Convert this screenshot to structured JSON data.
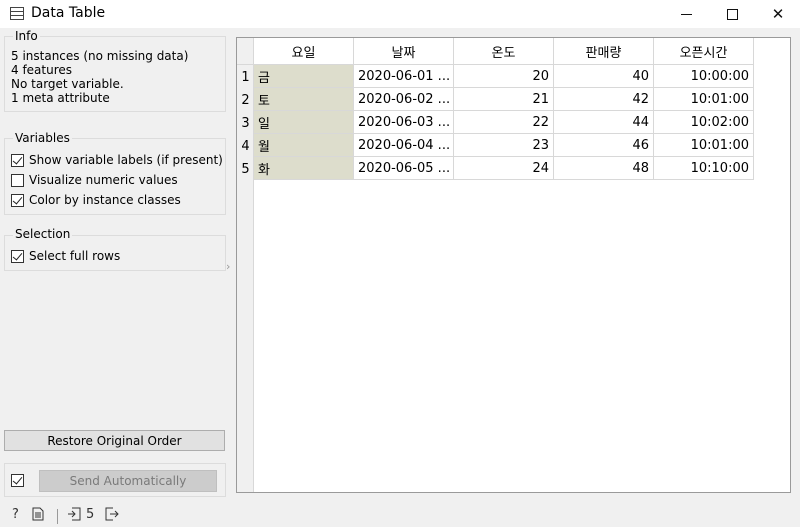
{
  "window": {
    "title": "Data Table",
    "minimize_icon": "minimize-icon",
    "maximize_icon": "maximize-icon",
    "close_icon": "close-icon",
    "close_glyph": "✕"
  },
  "info": {
    "title": "Info",
    "lines": [
      "5 instances (no missing data)",
      "4 features",
      "No target variable.",
      "1 meta attribute"
    ]
  },
  "variables": {
    "title": "Variables",
    "options": [
      {
        "label": "Show variable labels (if present)",
        "checked": true
      },
      {
        "label": "Visualize numeric values",
        "checked": false
      },
      {
        "label": "Color by instance classes",
        "checked": true
      }
    ]
  },
  "selection": {
    "title": "Selection",
    "options": [
      {
        "label": "Select full rows",
        "checked": true
      }
    ]
  },
  "buttons": {
    "restore": "Restore Original Order",
    "send": "Send Automatically",
    "send_checked": true
  },
  "table": {
    "columns": [
      "요일",
      "날짜",
      "온도",
      "판매량",
      "오픈시간"
    ],
    "rows": [
      {
        "num": "1",
        "cells": [
          "금",
          "2020-06-01 ...",
          "20",
          "40",
          "10:00:00"
        ]
      },
      {
        "num": "2",
        "cells": [
          "토",
          "2020-06-02 ...",
          "21",
          "42",
          "10:01:00"
        ]
      },
      {
        "num": "3",
        "cells": [
          "일",
          "2020-06-03 ...",
          "22",
          "44",
          "10:02:00"
        ]
      },
      {
        "num": "4",
        "cells": [
          "월",
          "2020-06-04 ...",
          "23",
          "46",
          "10:01:00"
        ]
      },
      {
        "num": "5",
        "cells": [
          "화",
          "2020-06-05 ...",
          "24",
          "48",
          "10:10:00"
        ]
      }
    ],
    "meta_color": "#ddddcc"
  },
  "statusbar": {
    "help_glyph": "?",
    "input_count": "5"
  }
}
